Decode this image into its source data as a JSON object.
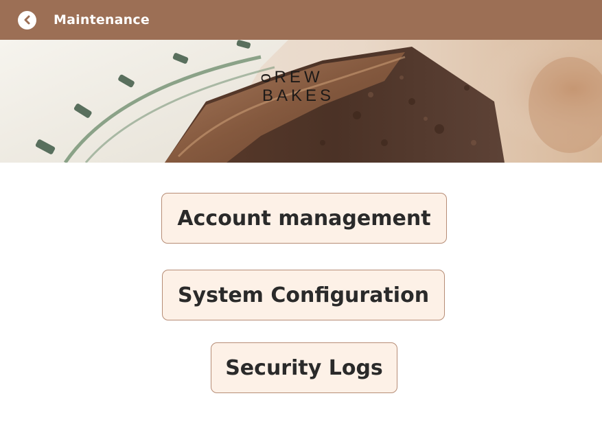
{
  "header": {
    "title": "Maintenance",
    "back_icon": "chevron-left-circle-icon",
    "background_color": "#9c6f55"
  },
  "banner": {
    "logo_line1": "ᴑREW",
    "logo_line2": "BAKES"
  },
  "menu": {
    "account_label": "Account management",
    "system_label": "System Configuration",
    "security_label": "Security Logs"
  },
  "colors": {
    "button_bg": "#fdf1e7",
    "button_border": "#b68c75",
    "button_text": "#2a2a2a"
  }
}
